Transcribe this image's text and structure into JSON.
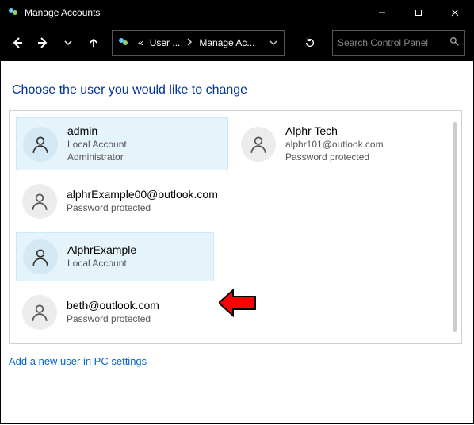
{
  "window": {
    "title": "Manage Accounts"
  },
  "address": {
    "prehist": "«",
    "seg1": "User ...",
    "seg2": "Manage Ac..."
  },
  "search": {
    "placeholder": "Search Control Panel"
  },
  "page": {
    "heading": "Choose the user you would like to change",
    "add_link": "Add a new user in PC settings"
  },
  "accounts": [
    {
      "name": "admin",
      "line1": "Local Account",
      "line2": "Administrator",
      "selected": true
    },
    {
      "name": "Alphr Tech",
      "line1": "alphr101@outlook.com",
      "line2": "Password protected",
      "selected": false
    },
    {
      "name": "alphrExample00@outlook.com",
      "line1": "Password protected",
      "line2": "",
      "selected": false
    },
    {
      "name": "AlphrExample",
      "line1": "Local Account",
      "line2": "",
      "selected": true
    },
    {
      "name": "beth@outlook.com",
      "line1": "Password protected",
      "line2": "",
      "selected": false
    }
  ]
}
